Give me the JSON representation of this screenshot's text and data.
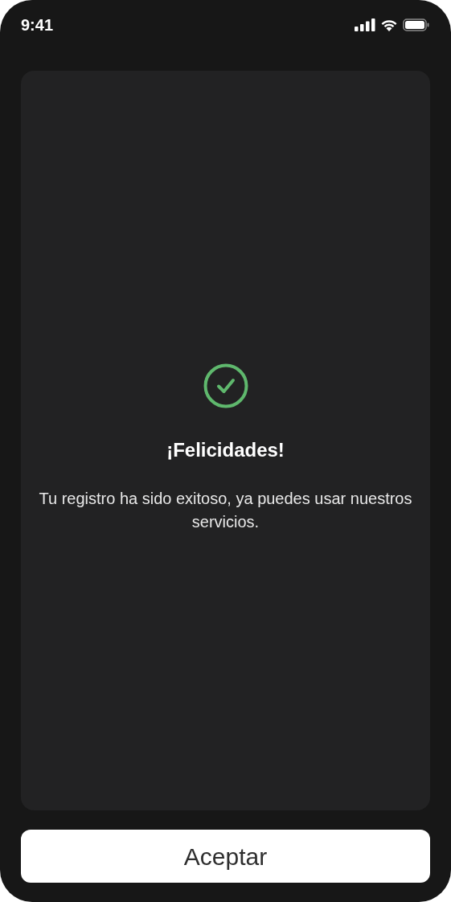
{
  "status_bar": {
    "time": "9:41"
  },
  "message": {
    "title": "¡Felicidades!",
    "body": "Tu registro ha sido exitoso, ya puedes usar nuestros servicios."
  },
  "button": {
    "label": "Aceptar"
  }
}
